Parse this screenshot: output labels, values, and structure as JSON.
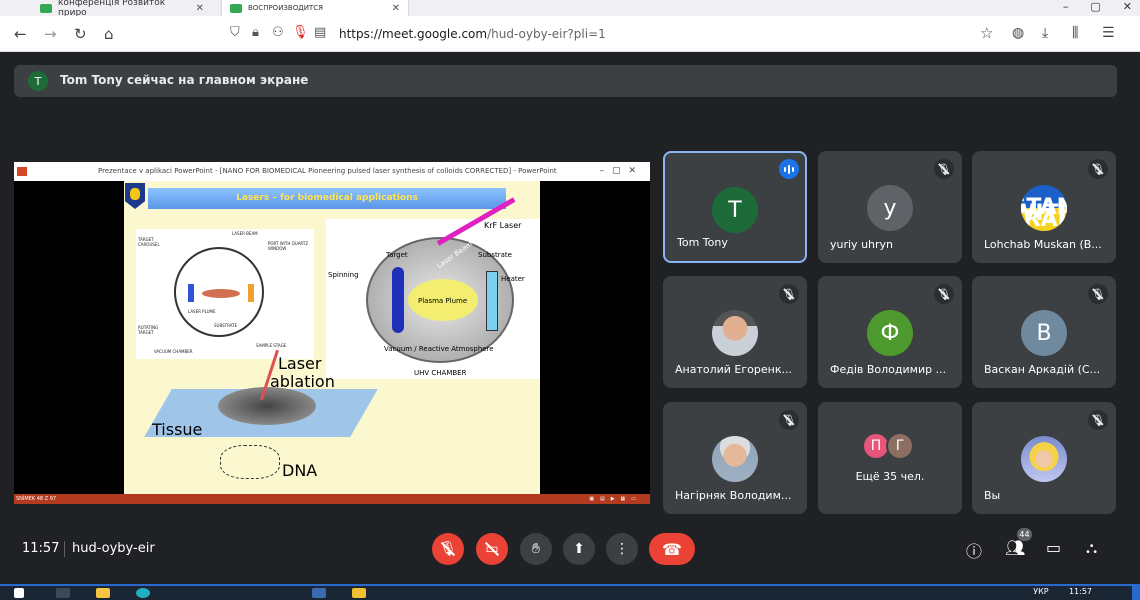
{
  "browser": {
    "tabs": [
      {
        "label": "конференція Розвиток приро"
      },
      {
        "label": "ВОСПРОИЗВОДИТСЯ"
      }
    ],
    "url_host": "https://meet.google.com",
    "url_path": "/hud-oyby-eir?pli=1"
  },
  "banner": {
    "avatar_letter": "T",
    "text": "Tom Tony сейчас на главном экране"
  },
  "presentation": {
    "window_title": "Prezentace v aplikaci PowerPoint - [NANO FOR BIOMEDICAL Pioneering pulsed laser synthesis of colloids CORRECTED] - PowerPoint",
    "slide_title": "Lasers – for biomedical applications",
    "diagram1_labels": {
      "laser_beam": "LASER BEAM",
      "target_carousel": "TARGET CAROUSEL",
      "port": "PORT WITH QUARTZ WINDOW",
      "laser_plume": "LASER PLUME",
      "substrate": "SUBSTRATE",
      "rotating_target": "ROTATING TARGET",
      "vacuum_chamber": "VACUUM CHAMBER",
      "sample_stage": "SAMPLE STAGE"
    },
    "diagram2_labels": {
      "krf": "KrF Laser",
      "laser_beam": "Laser Beam",
      "target": "Target",
      "substrate": "Substrate",
      "spinning": "Spinning",
      "plasma": "Plasma Plume",
      "heater": "Heater",
      "vacuum": "Vacuum / Reactive Atmosphere",
      "uhv": "UHV CHAMBER"
    },
    "laser_ablation_1": "Laser",
    "laser_ablation_2": "ablation",
    "tissue": "Tissue",
    "dna": "DNA",
    "status_left": "SNÍMEK 48 Z 97"
  },
  "participants": [
    {
      "name": "Tom Tony",
      "letter": "T",
      "color": "#1e6b3a",
      "speaking": true
    },
    {
      "name": "yuriy uhryn",
      "letter": "y",
      "color": "#5f6368"
    },
    {
      "name": "Lohchab Muskan (B...",
      "badge": "I STAND WITH UKRAINE"
    },
    {
      "name": "Анатолий Егоренк..."
    },
    {
      "name": "Федів Володимир ...",
      "letter": "Ф",
      "color": "#4e9a2e"
    },
    {
      "name": "Васкан Аркадій (С...",
      "letter": "В",
      "color": "#6f8a9e"
    },
    {
      "name": "Нагірняк Володим..."
    },
    {
      "more_letters": [
        "П",
        "Г"
      ],
      "more_colors": [
        "#e7557a",
        "#8d6e63"
      ],
      "more_text": "Ещё 35 чел."
    },
    {
      "name": "Вы"
    }
  ],
  "bottom": {
    "time": "11:57",
    "meeting_code": "hud-oyby-eir",
    "participant_count": "44"
  },
  "taskbar": {
    "lang": "УКР",
    "time": "11:57"
  }
}
